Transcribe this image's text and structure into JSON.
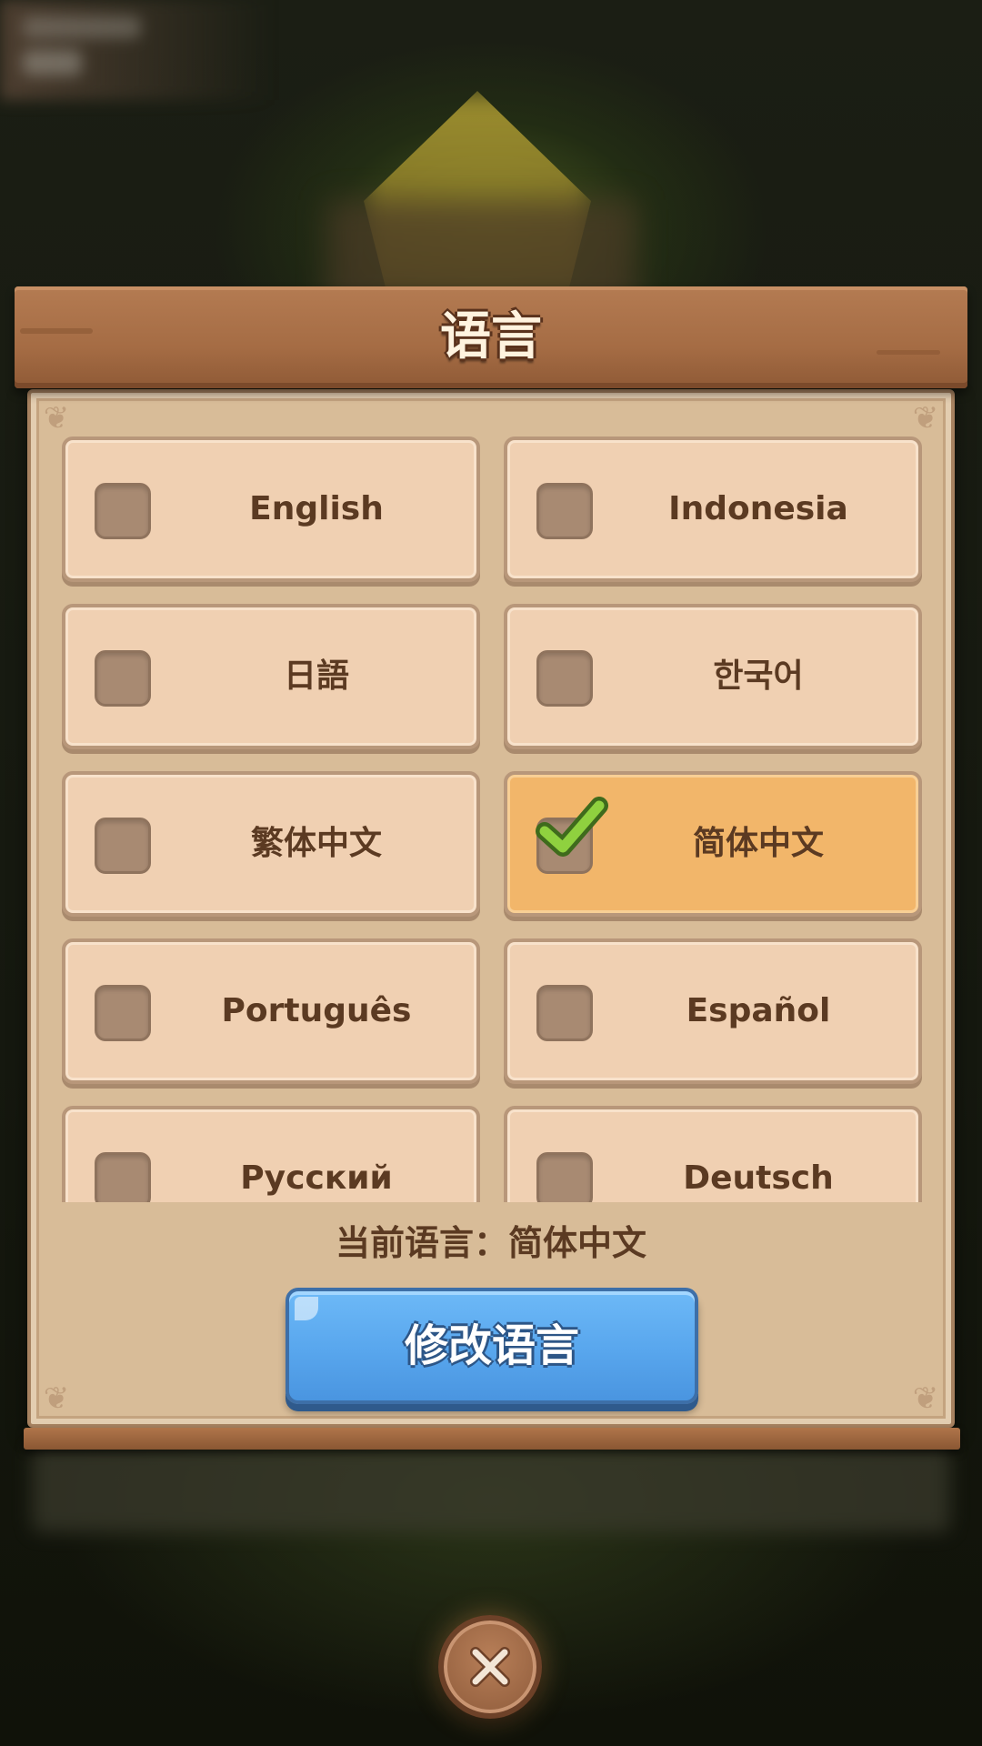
{
  "dialog": {
    "title": "语言",
    "languages": [
      {
        "label": "English",
        "selected": false
      },
      {
        "label": "Indonesia",
        "selected": false
      },
      {
        "label": "日語",
        "selected": false
      },
      {
        "label": "한국어",
        "selected": false
      },
      {
        "label": "繁体中文",
        "selected": false
      },
      {
        "label": "简体中文",
        "selected": true
      },
      {
        "label": "Português",
        "selected": false
      },
      {
        "label": "Español",
        "selected": false
      },
      {
        "label": "Русский",
        "selected": false
      },
      {
        "label": "Deutsch",
        "selected": false
      }
    ],
    "current_language_text": "当前语言：简体中文",
    "confirm_label": "修改语言"
  },
  "icons": {
    "checkmark": "checkmark-icon",
    "close": "close-icon"
  },
  "colors": {
    "selected_bg": "#f2b66a",
    "option_bg": "#f0d0b2",
    "confirm_blue": "#58a6ed",
    "check_green": "#8fd13f"
  }
}
